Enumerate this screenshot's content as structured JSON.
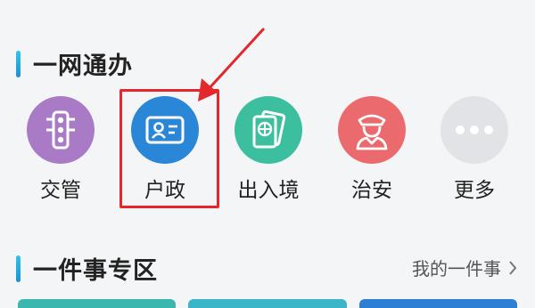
{
  "section_one": {
    "title": "一网通办"
  },
  "services": [
    {
      "label": "交管",
      "icon": "traffic-light-icon",
      "color": "#a97bc6"
    },
    {
      "label": "户政",
      "icon": "id-card-icon",
      "color": "#2a86d6"
    },
    {
      "label": "出入境",
      "icon": "passport-icon",
      "color": "#3cbf9f"
    },
    {
      "label": "治安",
      "icon": "police-officer-icon",
      "color": "#eb6a6e"
    },
    {
      "label": "更多",
      "icon": "more-dots-icon",
      "color": "#e2e3e6"
    }
  ],
  "highlight_color": "#e4272b",
  "section_two": {
    "title": "一件事专区",
    "link": "我的一件事"
  },
  "accent_colors": [
    "#2fc6e8",
    "#1e8ed9"
  ]
}
